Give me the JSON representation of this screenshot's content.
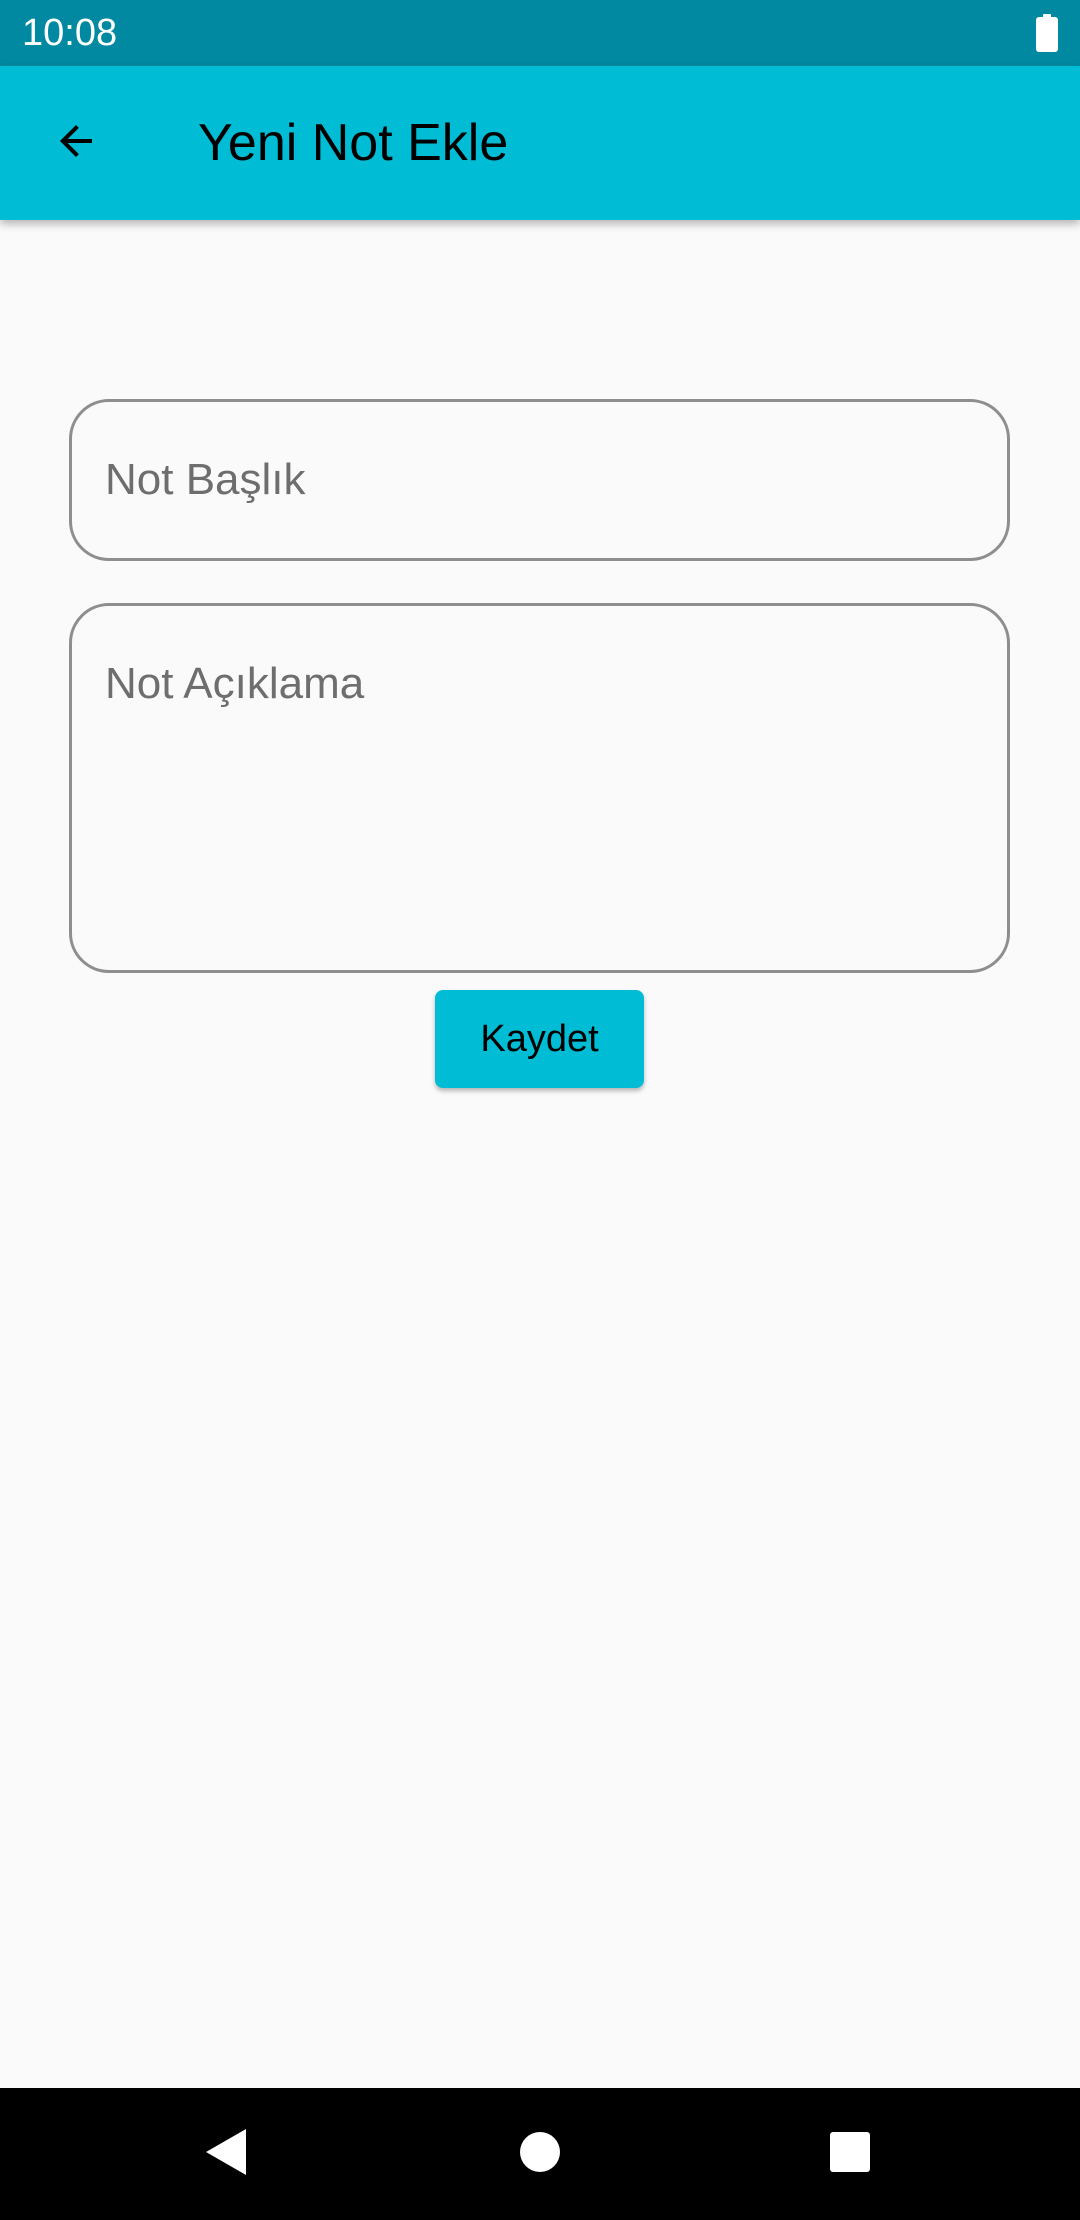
{
  "status_bar": {
    "time": "10:08",
    "battery_icon": "battery-full-icon"
  },
  "app_bar": {
    "title": "Yeni Not Ekle",
    "back_icon": "arrow-back-icon"
  },
  "form": {
    "title_field": {
      "placeholder": "Not Başlık",
      "value": ""
    },
    "description_field": {
      "placeholder": "Not Açıklama",
      "value": ""
    },
    "save_label": "Kaydet"
  },
  "nav_bar": {
    "back_icon": "nav-back-triangle-icon",
    "home_icon": "nav-home-circle-icon",
    "recents_icon": "nav-recents-square-icon"
  },
  "colors": {
    "status_bar": "#0089A1",
    "accent": "#00BCD4",
    "background": "#FAFAFA",
    "field_border": "#8E8E8E",
    "nav_bar": "#000000"
  }
}
